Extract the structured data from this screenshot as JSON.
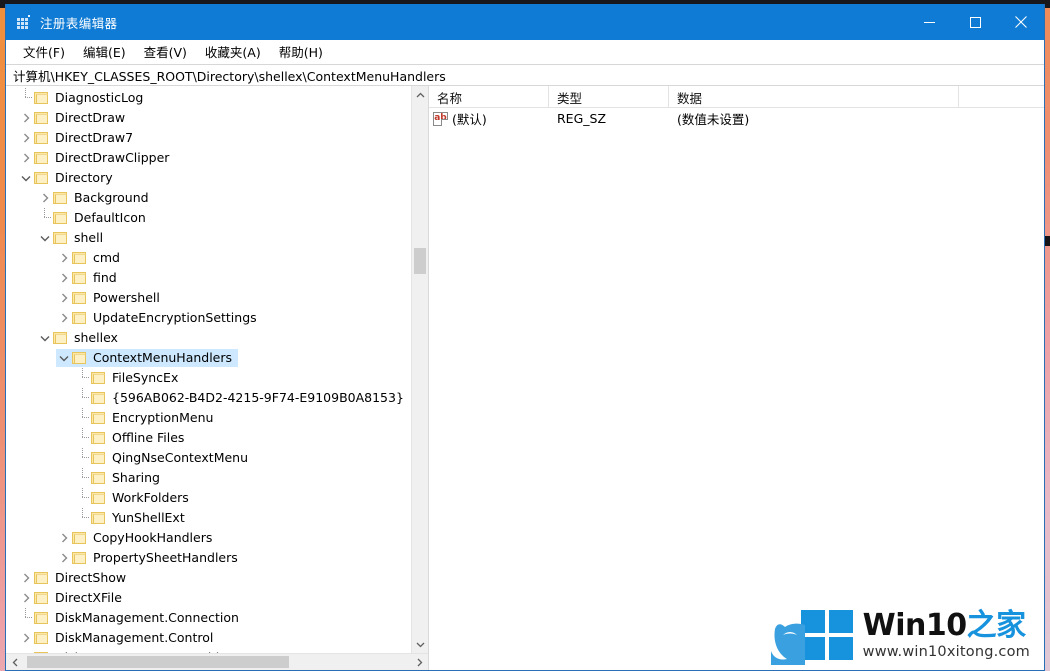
{
  "window": {
    "title": "注册表编辑器",
    "icon": "registry-editor-icon",
    "controls": {
      "minimize": "最小化",
      "maximize": "最大化",
      "close": "关闭"
    }
  },
  "menubar": {
    "items": [
      {
        "label": "文件(F)",
        "name": "menu-file"
      },
      {
        "label": "编辑(E)",
        "name": "menu-edit"
      },
      {
        "label": "查看(V)",
        "name": "menu-view"
      },
      {
        "label": "收藏夹(A)",
        "name": "menu-favorites"
      },
      {
        "label": "帮助(H)",
        "name": "menu-help"
      }
    ]
  },
  "address": {
    "path": "计算机\\HKEY_CLASSES_ROOT\\Directory\\shellex\\ContextMenuHandlers"
  },
  "tree": {
    "rows": [
      {
        "label": "DiagnosticLog",
        "indent": 1,
        "twisty": "none",
        "connector": "elbow"
      },
      {
        "label": "DirectDraw",
        "indent": 1,
        "twisty": "collapsed",
        "connector": "none"
      },
      {
        "label": "DirectDraw7",
        "indent": 1,
        "twisty": "collapsed",
        "connector": "none"
      },
      {
        "label": "DirectDrawClipper",
        "indent": 1,
        "twisty": "collapsed",
        "connector": "none"
      },
      {
        "label": "Directory",
        "indent": 1,
        "twisty": "expanded",
        "connector": "none"
      },
      {
        "label": "Background",
        "indent": 2,
        "twisty": "collapsed",
        "connector": "none"
      },
      {
        "label": "DefaultIcon",
        "indent": 2,
        "twisty": "none",
        "connector": "elbow"
      },
      {
        "label": "shell",
        "indent": 2,
        "twisty": "expanded",
        "connector": "none"
      },
      {
        "label": "cmd",
        "indent": 3,
        "twisty": "collapsed",
        "connector": "none"
      },
      {
        "label": "find",
        "indent": 3,
        "twisty": "collapsed",
        "connector": "none"
      },
      {
        "label": "Powershell",
        "indent": 3,
        "twisty": "collapsed",
        "connector": "none"
      },
      {
        "label": "UpdateEncryptionSettings",
        "indent": 3,
        "twisty": "collapsed",
        "connector": "none"
      },
      {
        "label": "shellex",
        "indent": 2,
        "twisty": "expanded",
        "connector": "none"
      },
      {
        "label": "ContextMenuHandlers",
        "indent": 3,
        "twisty": "expanded",
        "connector": "none",
        "selected": true
      },
      {
        "label": "FileSyncEx",
        "indent": 4,
        "twisty": "none",
        "connector": "elbow"
      },
      {
        "label": "{596AB062-B4D2-4215-9F74-E9109B0A8153}",
        "indent": 4,
        "twisty": "none",
        "connector": "elbow"
      },
      {
        "label": "EncryptionMenu",
        "indent": 4,
        "twisty": "none",
        "connector": "elbow"
      },
      {
        "label": "Offline Files",
        "indent": 4,
        "twisty": "none",
        "connector": "elbow"
      },
      {
        "label": "QingNseContextMenu",
        "indent": 4,
        "twisty": "none",
        "connector": "elbow"
      },
      {
        "label": "Sharing",
        "indent": 4,
        "twisty": "none",
        "connector": "elbow"
      },
      {
        "label": "WorkFolders",
        "indent": 4,
        "twisty": "none",
        "connector": "elbow"
      },
      {
        "label": "YunShellExt",
        "indent": 4,
        "twisty": "none",
        "connector": "elbow"
      },
      {
        "label": "CopyHookHandlers",
        "indent": 3,
        "twisty": "collapsed",
        "connector": "none"
      },
      {
        "label": "PropertySheetHandlers",
        "indent": 3,
        "twisty": "collapsed",
        "connector": "none"
      },
      {
        "label": "DirectShow",
        "indent": 1,
        "twisty": "collapsed",
        "connector": "none"
      },
      {
        "label": "DirectXFile",
        "indent": 1,
        "twisty": "collapsed",
        "connector": "none"
      },
      {
        "label": "DiskManagement.Connection",
        "indent": 1,
        "twisty": "none",
        "connector": "elbow"
      },
      {
        "label": "DiskManagement.Control",
        "indent": 1,
        "twisty": "collapsed",
        "connector": "none"
      },
      {
        "label": "DiskManagement.DataObject",
        "indent": 1,
        "twisty": "collapsed",
        "connector": "none"
      }
    ]
  },
  "values": {
    "columns": [
      "名称",
      "类型",
      "数据"
    ],
    "rows": [
      {
        "icon": "ab",
        "name": "(默认)",
        "type": "REG_SZ",
        "data": "(数值未设置)"
      }
    ]
  },
  "watermark": {
    "brand_black": "Win10",
    "brand_blue": "之家",
    "url": "www.win10xitong.com"
  }
}
